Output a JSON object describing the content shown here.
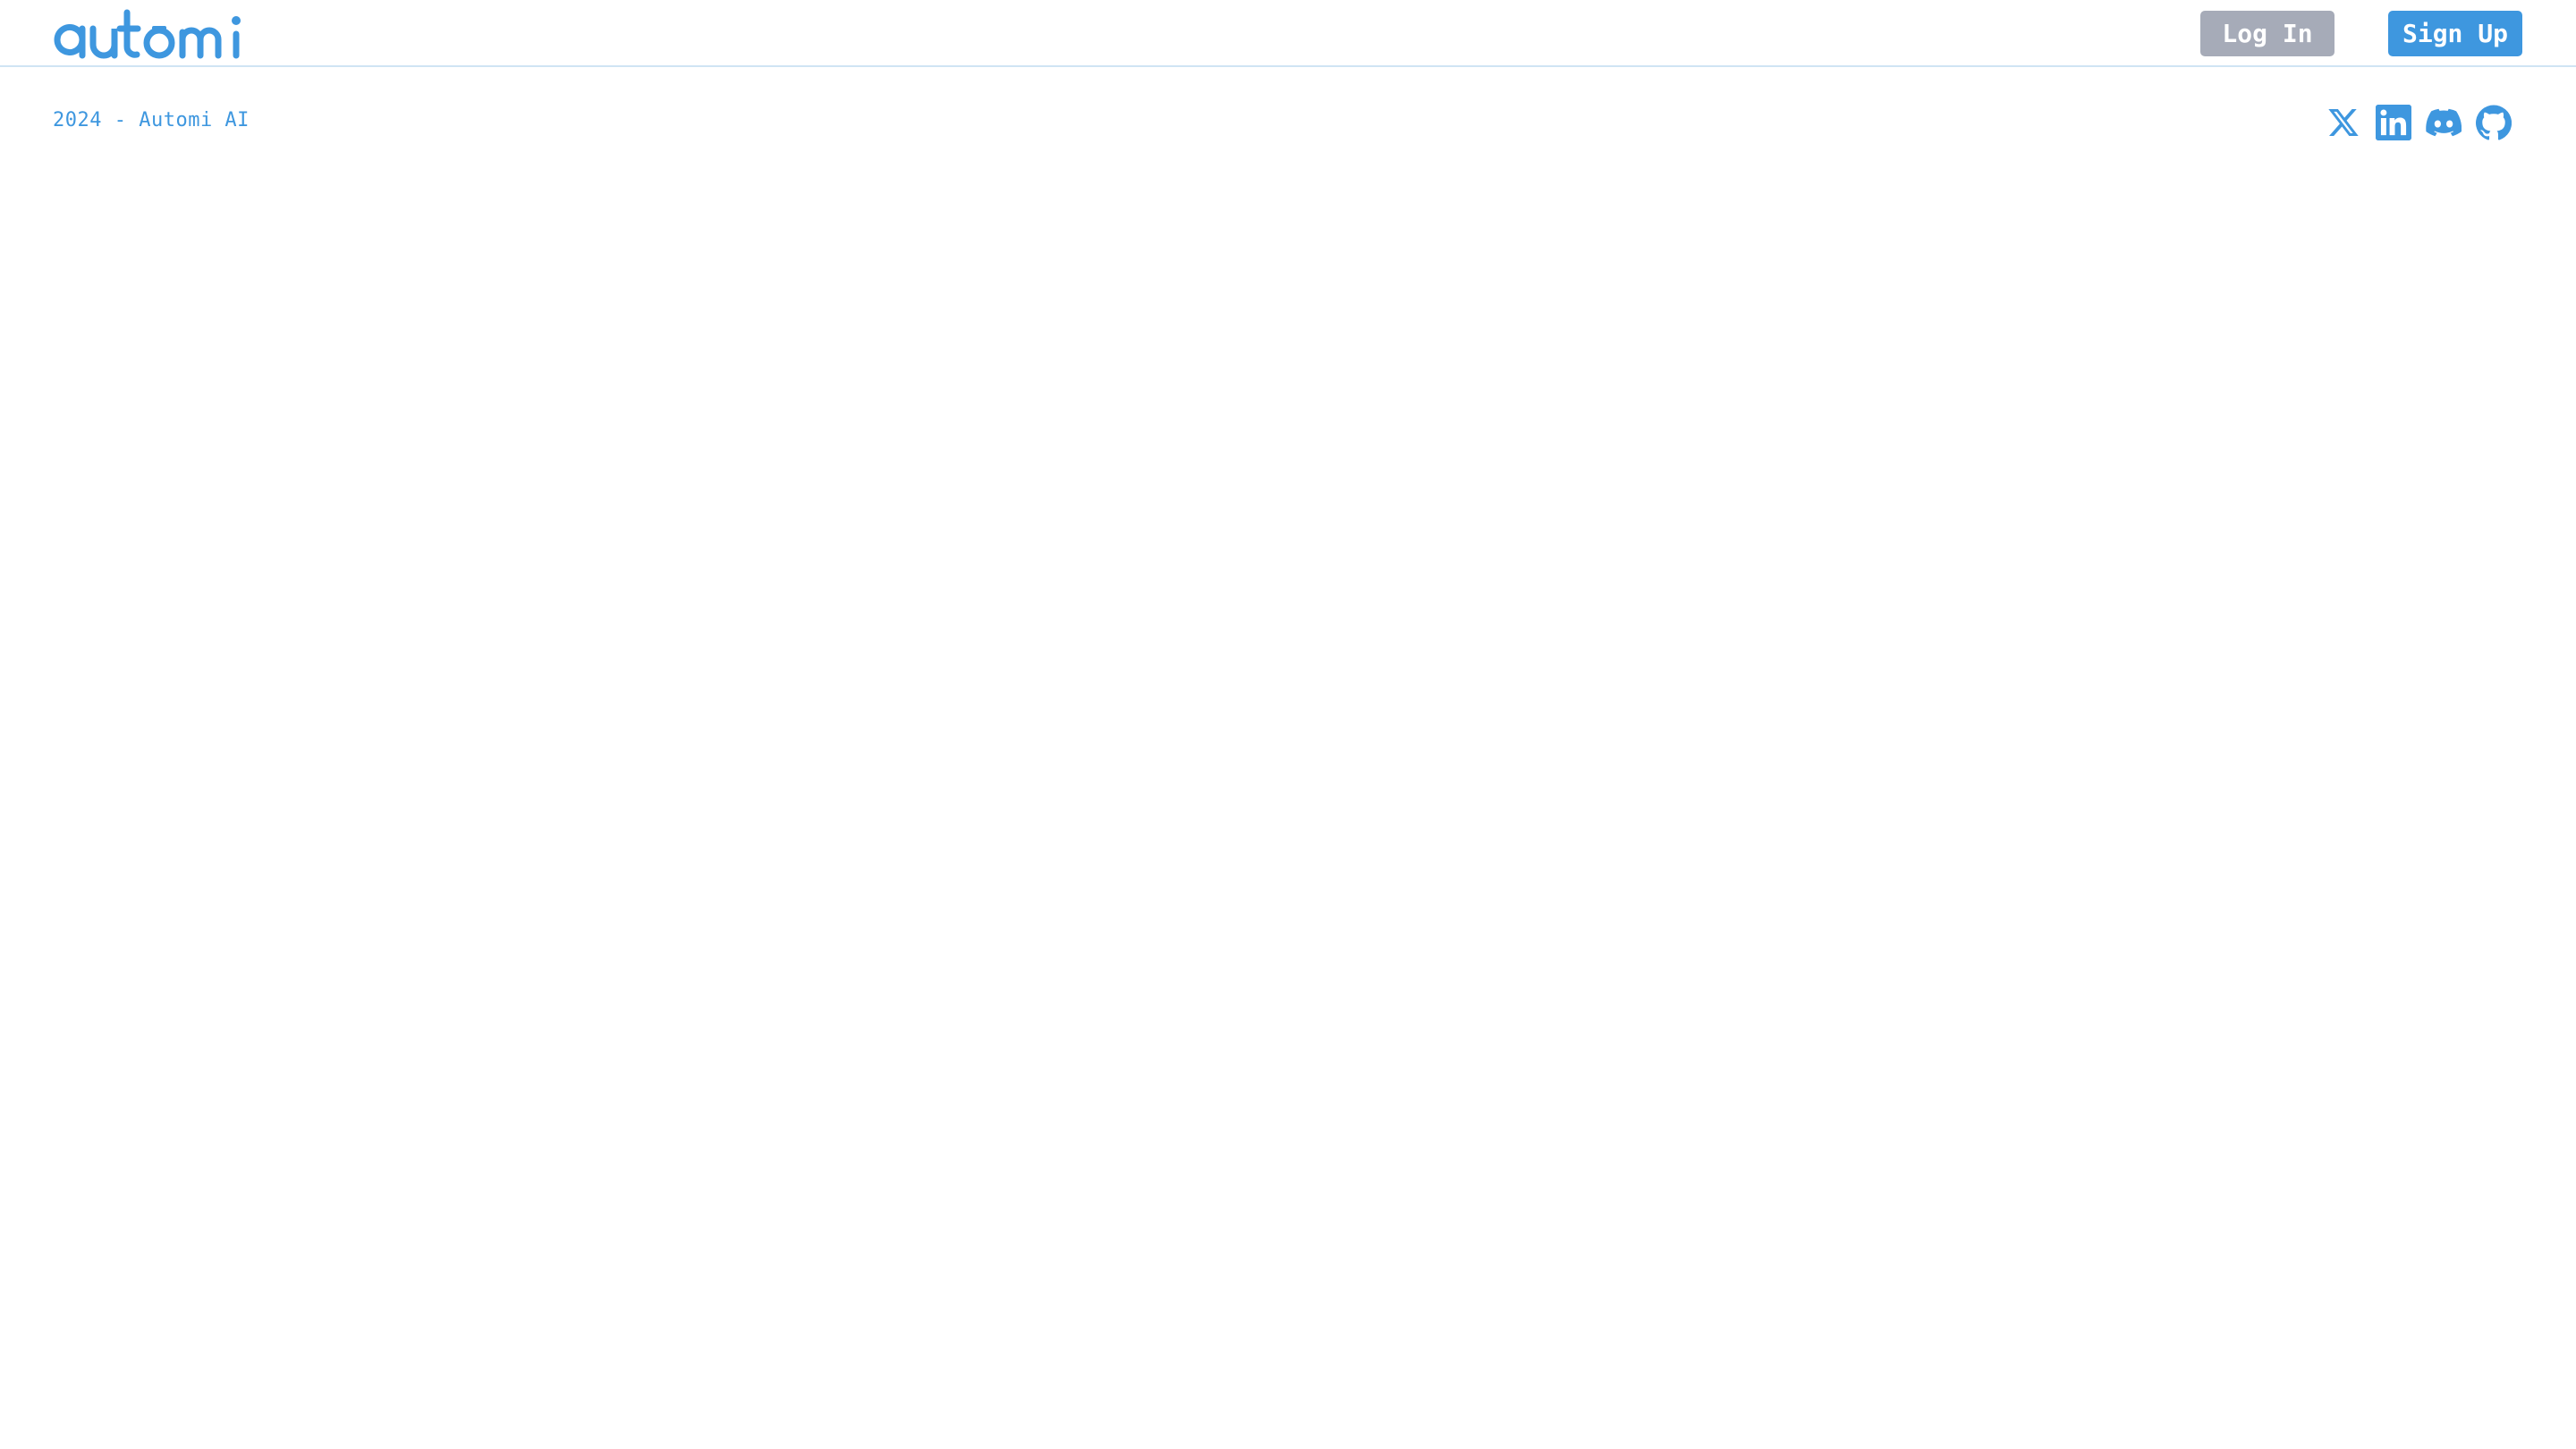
{
  "brand": {
    "logo_text": "automi",
    "color": "#3e97df"
  },
  "header": {
    "login_label": "Log In",
    "signup_label": "Sign Up",
    "login_color": "#a6abb8",
    "signup_color": "#3e97df"
  },
  "footer": {
    "copyright": "2024 - Automi AI",
    "social_icons": [
      "x-twitter-icon",
      "linkedin-icon",
      "discord-icon",
      "github-icon"
    ]
  }
}
